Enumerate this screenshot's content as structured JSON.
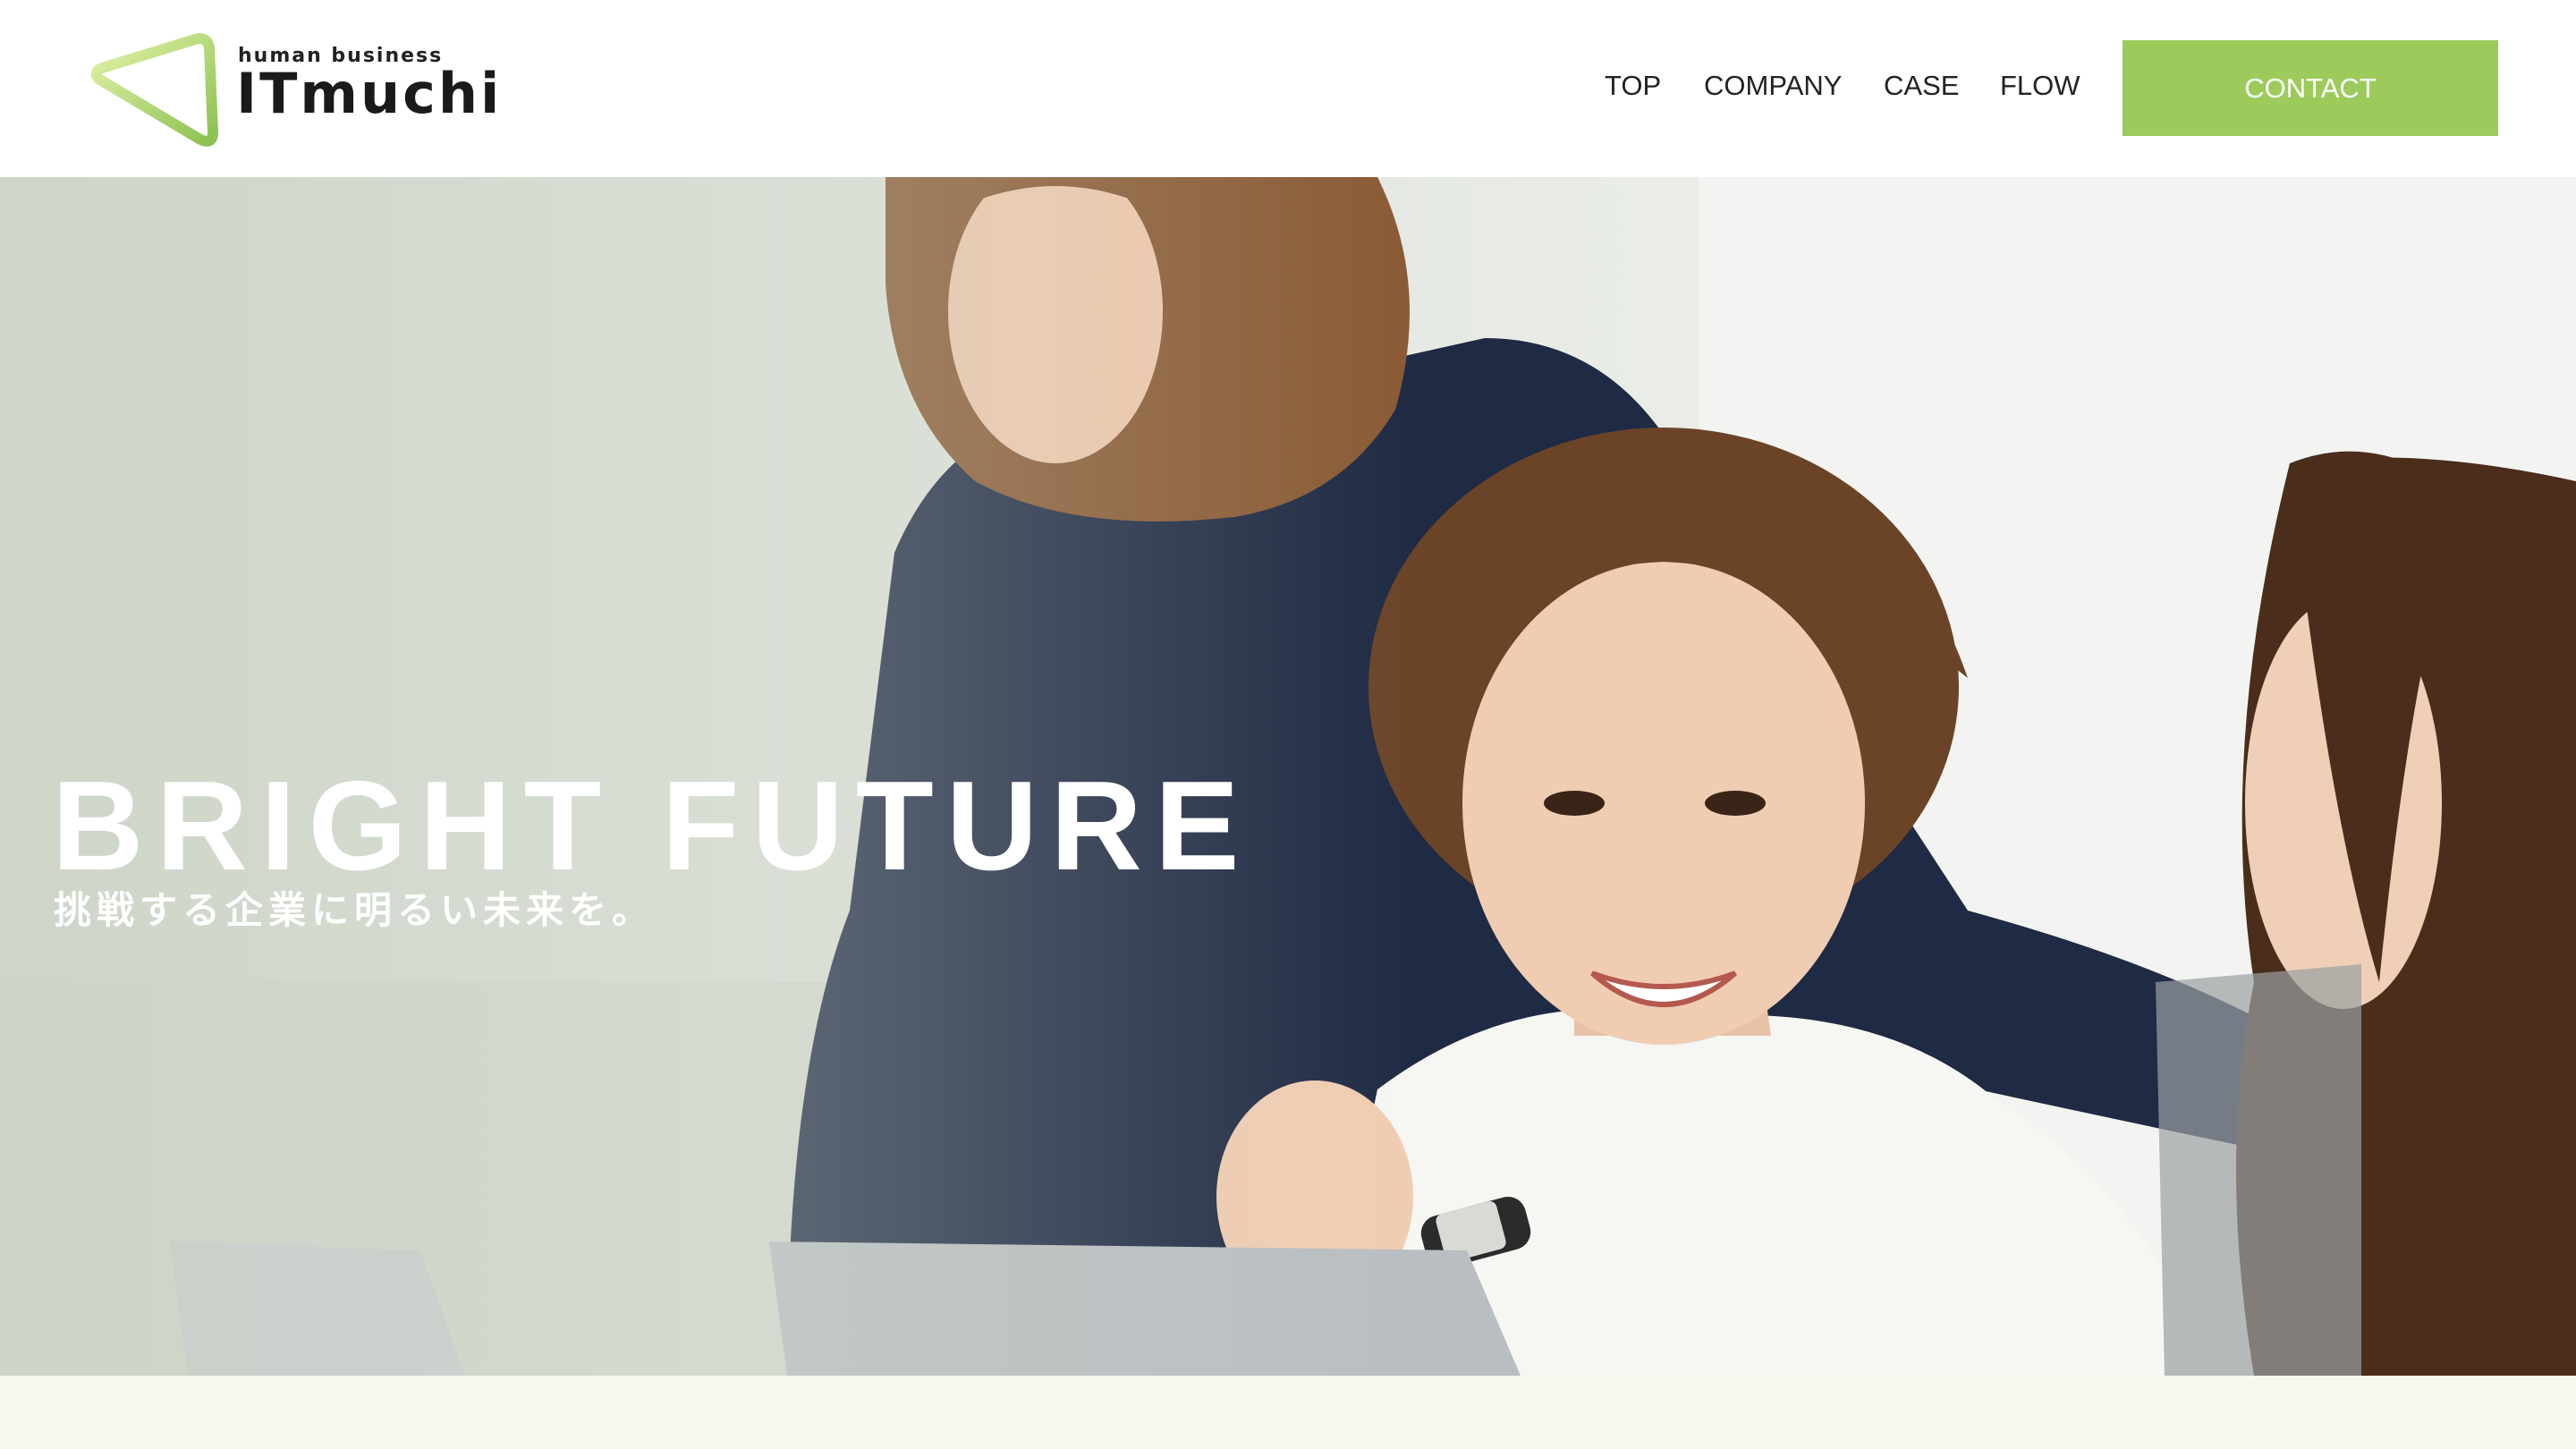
{
  "header": {
    "logo": {
      "sub": "human business",
      "main": "ITmuchi"
    },
    "nav": [
      {
        "label": "TOP"
      },
      {
        "label": "COMPANY"
      },
      {
        "label": "CASE"
      },
      {
        "label": "FLOW"
      }
    ],
    "contact_label": "CONTACT"
  },
  "hero": {
    "title": "BRIGHT FUTURE",
    "subtitle": "挑戦する企業に明るい未来を。",
    "image": "photo of three smiling women in an office meeting"
  },
  "colors": {
    "accent": "#9ccb5c",
    "bottom_band": "#f6faee",
    "text": "#222222"
  }
}
